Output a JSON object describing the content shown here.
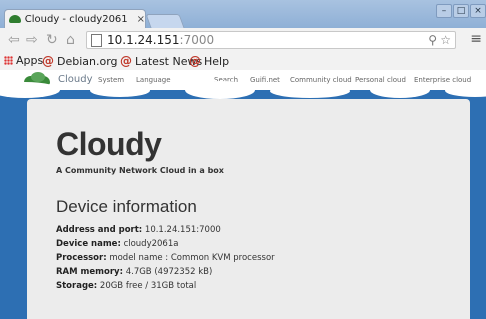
{
  "browser": {
    "tab_title": "Cloudy - cloudy2061",
    "tab_close": "×",
    "window_buttons": [
      "–",
      "□",
      "×"
    ],
    "url_host": "10.1.24.151",
    "url_port": ":7000",
    "back_icon": "back-arrow-icon",
    "menu_glyph": "≡"
  },
  "bookmarks": [
    {
      "label": "Apps",
      "icon": "apps-grid-icon"
    },
    {
      "label": "Debian.org",
      "icon": "debian-swirl-icon"
    },
    {
      "label": "Latest News",
      "icon": "debian-swirl-icon"
    },
    {
      "label": "Help",
      "icon": "debian-swirl-icon"
    }
  ],
  "site": {
    "brand": "Cloudy",
    "nav_left": [
      "System",
      "Language"
    ],
    "nav_right": [
      "Search",
      "Guifi.net",
      "Community cloud",
      "Personal cloud",
      "Enterprise cloud"
    ]
  },
  "main": {
    "title": "Cloudy",
    "tagline": "A Community Network Cloud in a box",
    "section_title": "Device information",
    "info": [
      {
        "label": "Address and port:",
        "value": "10.1.24.151:7000"
      },
      {
        "label": "Device name:",
        "value": "cloudy2061a"
      },
      {
        "label": "Processor:",
        "value": "model name : Common KVM processor"
      },
      {
        "label": "RAM memory:",
        "value": "4.7GB (4972352 kB)"
      },
      {
        "label": "Storage:",
        "value": "20GB free / 31GB total"
      }
    ]
  },
  "colors": {
    "page_bg": "#2d6fb3",
    "panel_bg": "#ececec",
    "logo_green": "#3a8a3a"
  }
}
